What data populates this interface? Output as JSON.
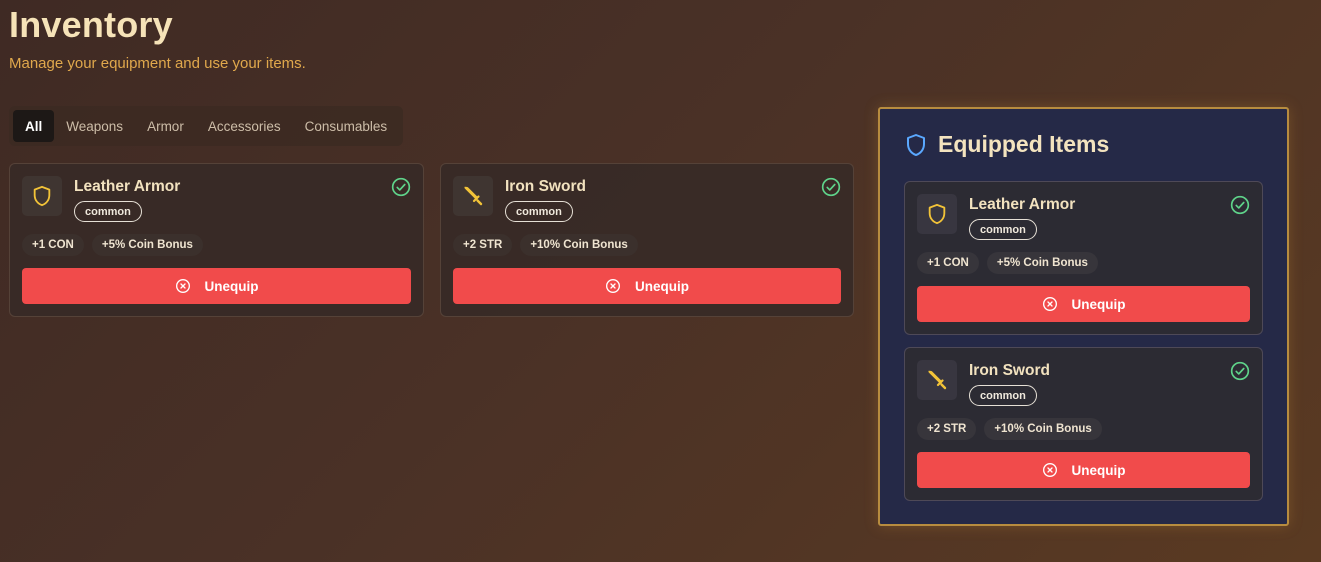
{
  "header": {
    "title": "Inventory",
    "subtitle": "Manage your equipment and use your items."
  },
  "tabs": [
    {
      "label": "All",
      "active": true
    },
    {
      "label": "Weapons",
      "active": false
    },
    {
      "label": "Armor",
      "active": false
    },
    {
      "label": "Accessories",
      "active": false
    },
    {
      "label": "Consumables",
      "active": false
    }
  ],
  "items": [
    {
      "name": "Leather Armor",
      "rarity": "common",
      "icon": "shield-icon",
      "stats": [
        "+1 CON",
        "+5% Coin Bonus"
      ],
      "button_label": "Unequip",
      "equipped": true
    },
    {
      "name": "Iron Sword",
      "rarity": "common",
      "icon": "sword-icon",
      "stats": [
        "+2 STR",
        "+10% Coin Bonus"
      ],
      "button_label": "Unequip",
      "equipped": true
    }
  ],
  "equipped": {
    "title": "Equipped Items",
    "icon": "shield-outline-icon",
    "items": [
      {
        "name": "Leather Armor",
        "rarity": "common",
        "icon": "shield-icon",
        "stats": [
          "+1 CON",
          "+5% Coin Bonus"
        ],
        "button_label": "Unequip"
      },
      {
        "name": "Iron Sword",
        "rarity": "common",
        "icon": "sword-icon",
        "stats": [
          "+2 STR",
          "+10% Coin Bonus"
        ],
        "button_label": "Unequip"
      }
    ]
  },
  "colors": {
    "accent_gold": "#e0a84c",
    "danger": "#f14b4b",
    "check_green": "#5fd38a",
    "panel_bg": "#252947",
    "panel_border": "#b78c3f"
  }
}
